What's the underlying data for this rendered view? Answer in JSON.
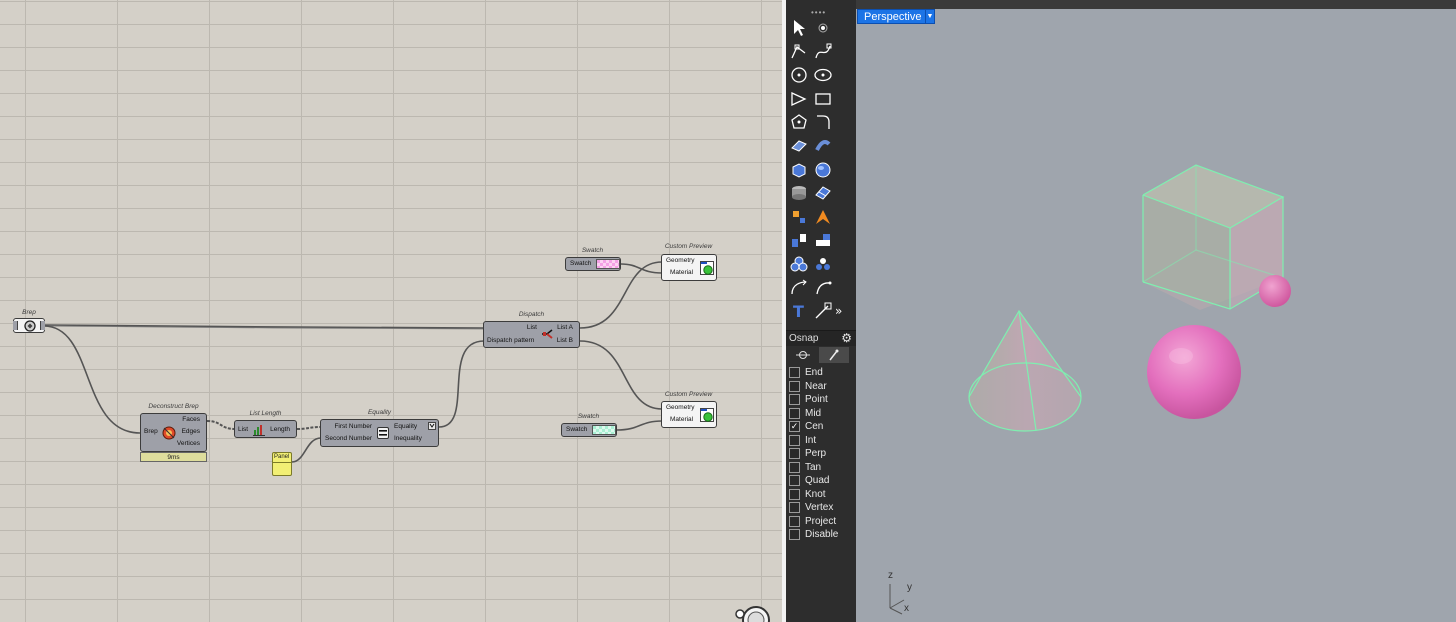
{
  "grasshopper": {
    "components": {
      "brep": {
        "title": "Brep"
      },
      "deconstruct_brep": {
        "title": "Deconstruct Brep",
        "input": "Brep",
        "outputs": [
          "Faces",
          "Edges",
          "Vertices"
        ],
        "timing": "9ms"
      },
      "list_length": {
        "title": "List Length",
        "input": "List",
        "output": "Length"
      },
      "equality": {
        "title": "Equality",
        "inputs": [
          "First Number",
          "Second Number"
        ],
        "outputs": [
          "Equality",
          "Inequality"
        ]
      },
      "panel": {
        "label": "Panel"
      },
      "dispatch": {
        "title": "Dispatch",
        "inputs": [
          "List",
          "Dispatch pattern"
        ],
        "outputs": [
          "List A",
          "List B"
        ]
      },
      "swatch_top": {
        "title": "Swatch",
        "label": "Swatch",
        "color": "#f4a0e6"
      },
      "swatch_bottom": {
        "title": "Swatch",
        "label": "Swatch",
        "color": "#a9f0d3"
      },
      "preview_top": {
        "title": "Custom Preview",
        "inputs": [
          "Geometry",
          "Material"
        ]
      },
      "preview_bottom": {
        "title": "Custom Preview",
        "inputs": [
          "Geometry",
          "Material"
        ]
      }
    }
  },
  "rhino": {
    "toolbar_icons": [
      "select-arrow-icon",
      "point-icon",
      "polyline-icon",
      "curve-icon",
      "circle-icon",
      "ellipse-icon",
      "polygon-icon",
      "rectangle-icon",
      "arc-icon",
      "fillet-icon",
      "surface-icon",
      "revolve-icon",
      "box-icon",
      "sphere-icon",
      "cylinder-icon",
      "mesh-icon",
      "explode-icon",
      "boolean-icon",
      "extrude-icon",
      "offset-icon",
      "solid-union-icon",
      "group-icon",
      "curve-tool-icon",
      "arc-tool-icon",
      "text-icon",
      "transform-icon",
      "more-icon"
    ],
    "osnap": {
      "title": "Osnap",
      "items": [
        {
          "label": "End",
          "checked": false
        },
        {
          "label": "Near",
          "checked": false
        },
        {
          "label": "Point",
          "checked": false
        },
        {
          "label": "Mid",
          "checked": false
        },
        {
          "label": "Cen",
          "checked": true
        },
        {
          "label": "Int",
          "checked": false
        },
        {
          "label": "Perp",
          "checked": false
        },
        {
          "label": "Tan",
          "checked": false
        },
        {
          "label": "Quad",
          "checked": false
        },
        {
          "label": "Knot",
          "checked": false
        },
        {
          "label": "Vertex",
          "checked": false
        },
        {
          "label": "Project",
          "checked": false
        },
        {
          "label": "Disable",
          "checked": false
        }
      ]
    },
    "viewport": {
      "name": "Perspective",
      "axes": {
        "z": "z",
        "y": "y",
        "x": "x"
      },
      "colors": {
        "background": "#9fa5ad",
        "pink": "#e36fbd",
        "edge": "#7ef0b0"
      }
    }
  }
}
